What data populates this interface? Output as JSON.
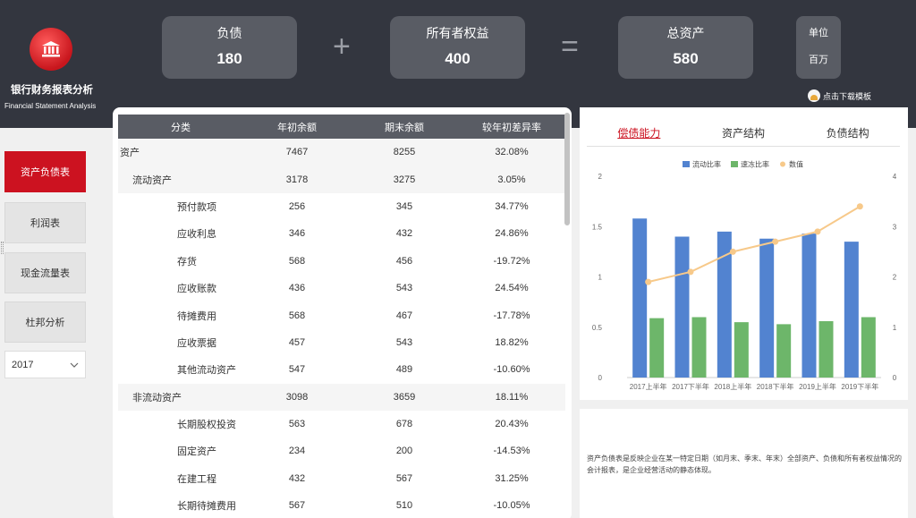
{
  "app": {
    "title": "银行财务报表分析",
    "subtitle": "Financial Statement Analysis"
  },
  "kpis": [
    {
      "label": "负债",
      "value": "180"
    },
    {
      "label": "所有者权益",
      "value": "400"
    },
    {
      "label": "总资产",
      "value": "580"
    }
  ],
  "operators": {
    "plus": "+",
    "equals": "="
  },
  "unit": {
    "label": "单位",
    "value": "百万"
  },
  "download": {
    "label": "点击下载模板"
  },
  "nav": [
    {
      "label": "资产负债表",
      "active": true
    },
    {
      "label": "利润表",
      "active": false
    },
    {
      "label": "现金流量表",
      "active": false
    },
    {
      "label": "杜邦分析",
      "active": false
    }
  ],
  "year": {
    "value": "2017"
  },
  "table": {
    "headers": [
      "分类",
      "年初余额",
      "期末余额",
      "较年初差异率"
    ],
    "rows": [
      {
        "name": "资产",
        "begin": "7467",
        "end": "8255",
        "diff": "32.08%",
        "level": 0
      },
      {
        "name": "流动资产",
        "begin": "3178",
        "end": "3275",
        "diff": "3.05%",
        "level": 1
      },
      {
        "name": "预付款项",
        "begin": "256",
        "end": "345",
        "diff": "34.77%",
        "level": 2
      },
      {
        "name": "应收利息",
        "begin": "346",
        "end": "432",
        "diff": "24.86%",
        "level": 2
      },
      {
        "name": "存货",
        "begin": "568",
        "end": "456",
        "diff": "-19.72%",
        "level": 2
      },
      {
        "name": "应收账款",
        "begin": "436",
        "end": "543",
        "diff": "24.54%",
        "level": 2
      },
      {
        "name": "待摊费用",
        "begin": "568",
        "end": "467",
        "diff": "-17.78%",
        "level": 2
      },
      {
        "name": "应收票据",
        "begin": "457",
        "end": "543",
        "diff": "18.82%",
        "level": 2
      },
      {
        "name": "其他流动资产",
        "begin": "547",
        "end": "489",
        "diff": "-10.60%",
        "level": 2
      },
      {
        "name": "非流动资产",
        "begin": "3098",
        "end": "3659",
        "diff": "18.11%",
        "level": 1
      },
      {
        "name": "长期股权投资",
        "begin": "563",
        "end": "678",
        "diff": "20.43%",
        "level": 2
      },
      {
        "name": "固定资产",
        "begin": "234",
        "end": "200",
        "diff": "-14.53%",
        "level": 2
      },
      {
        "name": "在建工程",
        "begin": "432",
        "end": "567",
        "diff": "31.25%",
        "level": 2
      },
      {
        "name": "长期待摊费用",
        "begin": "567",
        "end": "510",
        "diff": "-10.05%",
        "level": 2
      }
    ]
  },
  "tabs": [
    {
      "label": "偿债能力",
      "active": true
    },
    {
      "label": "资产结构",
      "active": false
    },
    {
      "label": "负债结构",
      "active": false
    }
  ],
  "chart_data": {
    "type": "bar",
    "categories": [
      "2017上半年",
      "2017下半年",
      "2018上半年",
      "2018下半年",
      "2019上半年",
      "2019下半年"
    ],
    "series": [
      {
        "name": "流动比率",
        "type": "bar",
        "axis": "left",
        "color": "#5283d0",
        "values": [
          1.58,
          1.4,
          1.45,
          1.38,
          1.43,
          1.35
        ]
      },
      {
        "name": "速冻比率",
        "type": "bar",
        "axis": "left",
        "color": "#6db66a",
        "values": [
          0.59,
          0.6,
          0.55,
          0.53,
          0.56,
          0.6
        ]
      },
      {
        "name": "数值",
        "type": "line",
        "axis": "right",
        "color": "#f7c98a",
        "values": [
          1.9,
          2.1,
          2.5,
          2.7,
          2.9,
          3.4
        ]
      }
    ],
    "yleft": {
      "ticks": [
        "0",
        "0.5",
        "1",
        "1.5",
        "2"
      ],
      "ylim": [
        0,
        2
      ]
    },
    "yright": {
      "ticks": [
        "0",
        "1",
        "2",
        "3",
        "4"
      ],
      "ylim": [
        0,
        4
      ]
    },
    "legend": "top",
    "grid": false
  },
  "note": "资产负债表是反映企业在某一特定日期（如月末、季末、年末）全部资产、负债和所有者权益情况的会计报表，是企业经营活动的静态体现。"
}
